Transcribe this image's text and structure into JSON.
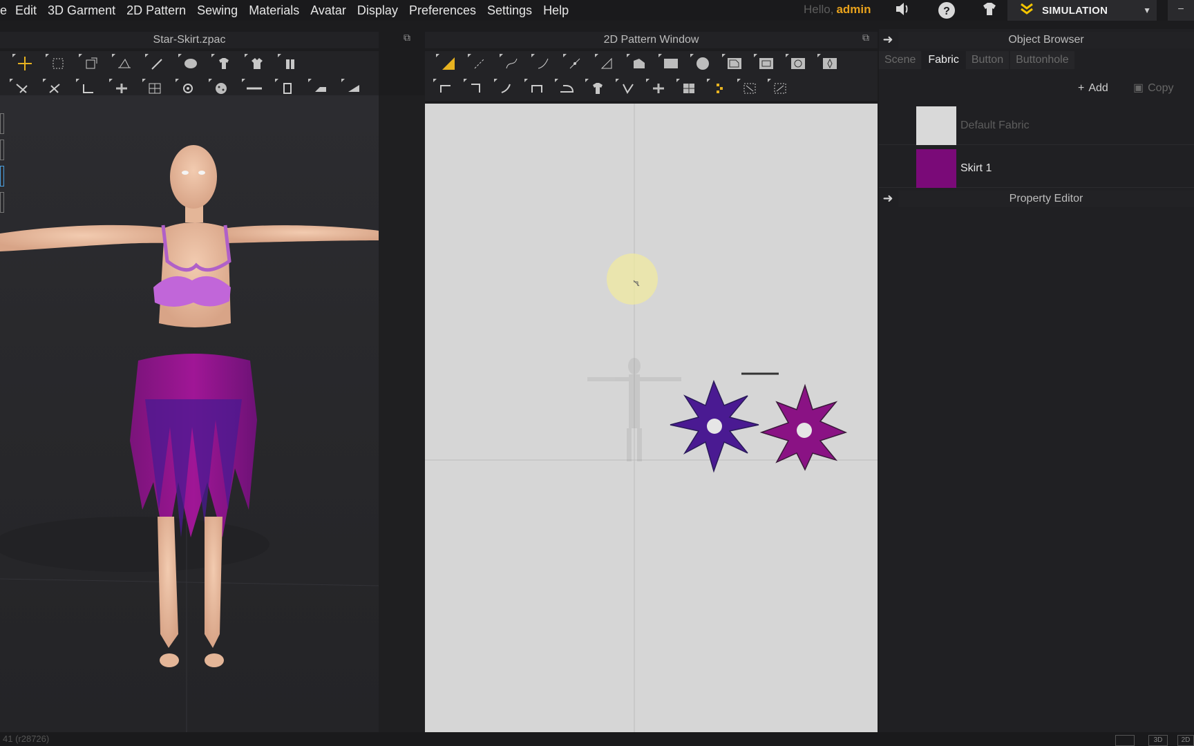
{
  "menu": {
    "items": [
      "Edit",
      "3D Garment",
      "2D Pattern",
      "Sewing",
      "Materials",
      "Avatar",
      "Display",
      "Preferences",
      "Settings",
      "Help"
    ]
  },
  "user": {
    "greeting": "Hello,",
    "name": "admin"
  },
  "mode": {
    "label": "SIMULATION"
  },
  "panels": {
    "view3d_title": "Star-Skirt.zpac",
    "view2d_title": "2D Pattern Window",
    "object_browser_title": "Object Browser",
    "property_editor_title": "Property Editor"
  },
  "object_browser": {
    "tabs": [
      "Scene",
      "Fabric",
      "Button",
      "Buttonhole"
    ],
    "active_tab": "Fabric",
    "add_label": "Add",
    "copy_label": "Copy",
    "fabrics": [
      {
        "name": "Default Fabric",
        "color": "#d9d9d9"
      },
      {
        "name": "Skirt 1",
        "color": "#7a0a78"
      }
    ]
  },
  "status": {
    "text": "41 (r28726)"
  },
  "view_buttons": [
    "",
    "3D",
    "2D"
  ],
  "colors": {
    "accent": "#e8a21c",
    "simulation": "#f2c400",
    "pattern_purple": "#4a1a92",
    "pattern_magenta": "#8a1284",
    "top": "#c166d9"
  }
}
